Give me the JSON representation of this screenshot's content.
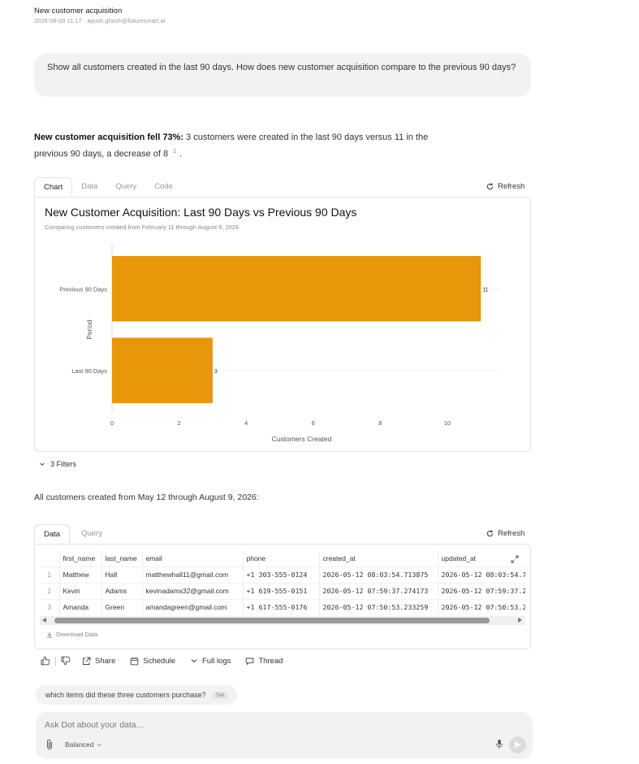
{
  "header": {
    "title": "New customer acquisition",
    "meta": "2026-08-09 11:17  ·  ayush.ghosh@futuresmart.ai"
  },
  "user_message": "Show all customers created in the last 90 days. How does new customer acquisition compare to the previous 90 days?",
  "answer": {
    "bold": "New customer acquisition fell 73%:",
    "text": " 3 customers were created in the last 90 days versus 11 in the previous 90 days, a decrease of 8",
    "footnote": "1",
    "end": "."
  },
  "chart_panel": {
    "tabs": [
      "Chart",
      "Data",
      "Query",
      "Code"
    ],
    "active_tab": "Chart",
    "refresh_label": "Refresh"
  },
  "chart_data": {
    "type": "bar",
    "orientation": "horizontal",
    "title": "New Customer Acquisition: Last 90 Days vs Previous 90 Days",
    "subtitle": "Comparing customers created from February 11 through August 9, 2026",
    "categories": [
      "Previous 90 Days",
      "Last 90 Days"
    ],
    "values": [
      11,
      3
    ],
    "data_labels": [
      "11",
      "3"
    ],
    "xlabel": "Customers Created",
    "ylabel": "Period",
    "xlim": [
      0,
      11.6
    ],
    "xticks": [
      0,
      2,
      4,
      6,
      8,
      10
    ],
    "color": "#e8960a",
    "grid": true
  },
  "filters_label": "3 Filters",
  "table_intro": "All customers created from May 12 through August 9, 2026:",
  "table_panel": {
    "tabs": [
      "Data",
      "Query"
    ],
    "active_tab": "Data",
    "refresh_label": "Refresh",
    "columns": [
      "first_name",
      "last_name",
      "email",
      "phone",
      "created_at",
      "updated_at"
    ],
    "rows": [
      {
        "idx": "1",
        "cells": [
          "Matthew",
          "Hall",
          "matthewhall11@gmail.com",
          "+1 303-555-0124",
          "2026-05-12 08:03:54.713875",
          "2026-05-12 08:03:54.7"
        ]
      },
      {
        "idx": "2",
        "cells": [
          "Kevin",
          "Adams",
          "kevinadams32@gmail.com",
          "+1 619-555-0151",
          "2026-05-12 07:59:37.274173",
          "2026-05-12 07:59:37.2"
        ]
      },
      {
        "idx": "3",
        "cells": [
          "Amanda",
          "Green",
          "amandagreen@gmail.com",
          "+1 617-555-0176",
          "2026-05-12 07:50:53.233259",
          "2026-05-12 07:50:53.2"
        ]
      }
    ],
    "download_label": "Download Data"
  },
  "actions": {
    "share": "Share",
    "schedule": "Schedule",
    "full_logs": "Full logs",
    "thread": "Thread"
  },
  "suggestion": {
    "text": "which items did these three customers purchase?",
    "kbd": "Tab"
  },
  "composer": {
    "placeholder": "Ask Dot about your data...",
    "mode": "Balanced"
  }
}
